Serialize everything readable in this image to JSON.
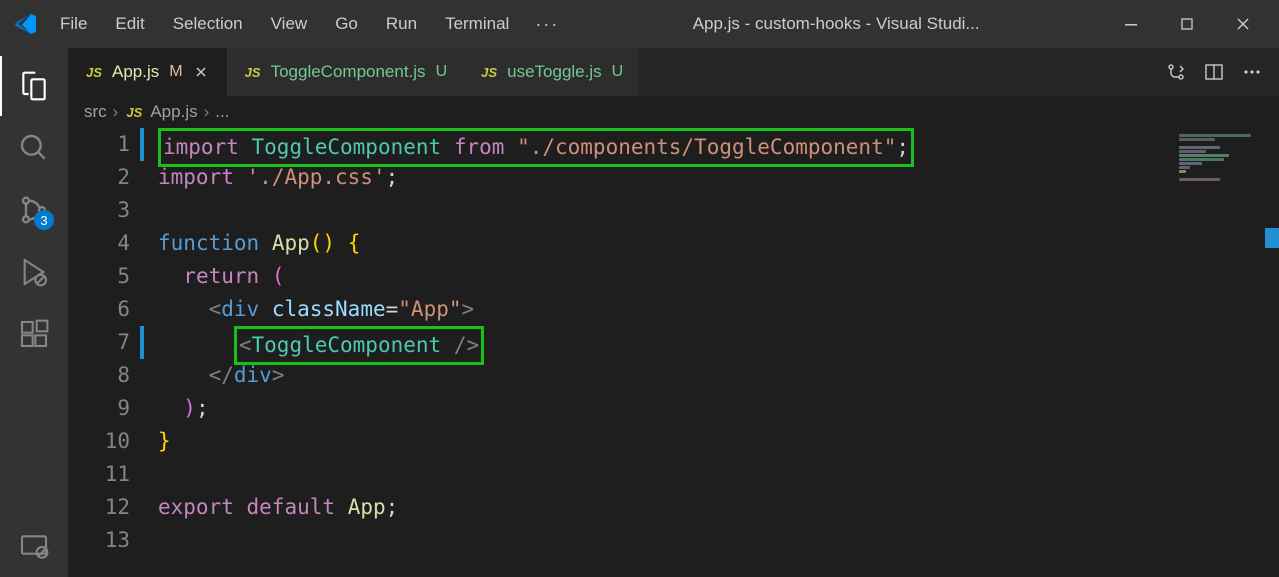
{
  "window": {
    "title": "App.js - custom-hooks - Visual Studi..."
  },
  "menu": [
    "File",
    "Edit",
    "Selection",
    "View",
    "Go",
    "Run",
    "Terminal"
  ],
  "overflow_dots": "···",
  "activity": {
    "scm_badge": "3"
  },
  "tabs": [
    {
      "icon": "JS",
      "label": "App.js",
      "status": "M",
      "active": true,
      "closable": true,
      "status_color": "#e2c08d"
    },
    {
      "icon": "JS",
      "label": "ToggleComponent.js",
      "status": "U",
      "active": false,
      "closable": false,
      "status_color": "#73c991"
    },
    {
      "icon": "JS",
      "label": "useToggle.js",
      "status": "U",
      "active": false,
      "closable": false,
      "status_color": "#73c991"
    }
  ],
  "breadcrumb": {
    "folder": "src",
    "file": "App.js",
    "ellipsis": "..."
  },
  "code": {
    "lines": [
      1,
      2,
      3,
      4,
      5,
      6,
      7,
      8,
      9,
      10,
      11,
      12,
      13
    ],
    "line1_import": "import",
    "line1_class": "ToggleComponent",
    "line1_from": "from",
    "line1_str": "\"./components/ToggleComponent\"",
    "line2_import": "import",
    "line2_str": "'./App.css'",
    "line4_func": "function",
    "line4_name": "App",
    "line5_return": "return",
    "line6_div": "div",
    "line6_attr": "className",
    "line6_val": "\"App\"",
    "line7_comp": "ToggleComponent",
    "line8_div": "div",
    "line12_export": "export",
    "line12_default": "default",
    "line12_name": "App"
  }
}
